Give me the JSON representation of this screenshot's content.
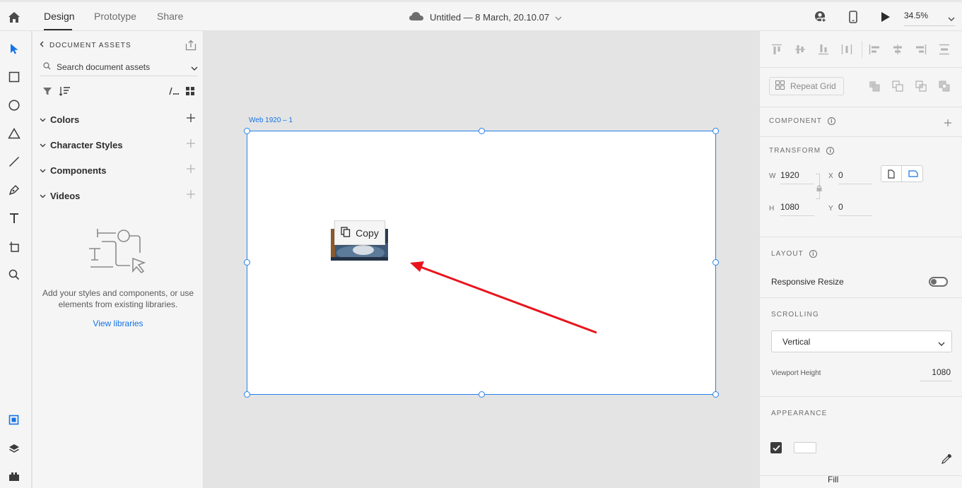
{
  "topbar": {
    "tabs": [
      {
        "label": "Design",
        "active": true
      },
      {
        "label": "Prototype",
        "active": false
      },
      {
        "label": "Share",
        "active": false
      }
    ],
    "document_title": "Untitled — 8 March, 20.10.07",
    "zoom": "34.5%",
    "icons": [
      "home-icon",
      "cloud-icon",
      "chevron-down-icon",
      "user-add-icon",
      "mobile-preview-icon",
      "play-icon"
    ]
  },
  "toolbar": {
    "tools": [
      "select-icon",
      "rectangle-icon",
      "ellipse-icon",
      "polygon-icon",
      "line-icon",
      "pen-icon",
      "text-icon",
      "artboard-icon",
      "zoom-icon"
    ],
    "bottom_tools": [
      "assets-icon",
      "layers-icon",
      "plugins-icon"
    ],
    "active_color": "#1473e6"
  },
  "assets": {
    "header": "DOCUMENT ASSETS",
    "search_placeholder": "Search document assets",
    "sections": [
      {
        "label": "Colors"
      },
      {
        "label": "Character Styles"
      },
      {
        "label": "Components"
      },
      {
        "label": "Videos"
      }
    ],
    "empty_text": "Add your styles and components, or use elements from existing libraries.",
    "view_libraries": "View libraries",
    "link_color": "#1473e6"
  },
  "canvas": {
    "artboard_label": "Web 1920 – 1",
    "copy_button": "Copy",
    "annotation_color": "#e8141c",
    "selection_color": "#2680eb"
  },
  "inspector": {
    "repeat_grid": "Repeat Grid",
    "component_title": "COMPONENT",
    "transform_title": "TRANSFORM",
    "w_label": "W",
    "w_value": "1920",
    "h_label": "H",
    "h_value": "1080",
    "x_label": "X",
    "x_value": "0",
    "y_label": "Y",
    "y_value": "0",
    "layout_title": "LAYOUT",
    "responsive_resize": "Responsive Resize",
    "responsive_resize_on": false,
    "scrolling_title": "SCROLLING",
    "scrolling_value": "Vertical",
    "viewport_height_label": "Viewport Height",
    "viewport_height_value": "1080",
    "appearance_title": "APPEARANCE",
    "fill_label": "Fill",
    "fill_enabled": true,
    "fill_color": "#ffffff"
  }
}
